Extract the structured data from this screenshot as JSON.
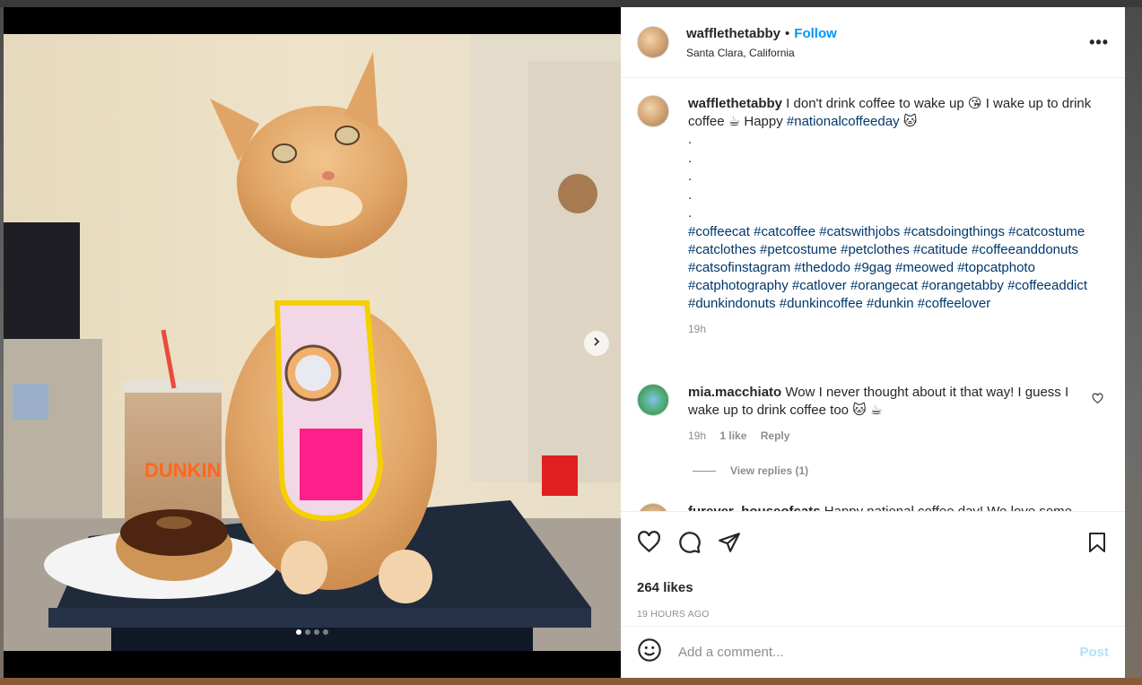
{
  "post": {
    "username": "wafflethetabby",
    "separator": "•",
    "follow_label": "Follow",
    "location": "Santa Clara, California",
    "more_label": "•••"
  },
  "caption": {
    "username": "wafflethetabby",
    "text_1": " I don't drink coffee to wake up 😘 I wake up to drink coffee ☕ Happy ",
    "tag_main": "#nationalcoffeeday",
    "emoji_end": " 🐱",
    "dots": [
      ".",
      ".",
      ".",
      ".",
      "."
    ],
    "hashtags": "#coffeecat #catcoffee #catswithjobs #catsdoingthings #catcostume #catclothes #petcostume #petclothes #catitude #coffeeanddonuts #catsofinstagram #thedodo #9gag #meowed #topcatphoto #catphotography #catlover #orangecat #orangetabby #coffeeaddict #dunkindonuts #dunkincoffee #dunkin #coffeelover",
    "time": "19h"
  },
  "comments": [
    {
      "username": "mia.macchiato",
      "text": " Wow I never thought about it that way! I guess I wake up to drink coffee too 🐱 ☕",
      "time": "19h",
      "likes": "1 like",
      "reply": "Reply"
    },
    {
      "username": "furever_houseofcats",
      "text": " Happy national coffee day! We love some"
    }
  ],
  "view_replies": "View replies (1)",
  "stats": {
    "likes": "264 likes",
    "timestamp": "19 HOURS AGO"
  },
  "add_comment": {
    "placeholder": "Add a comment...",
    "post_label": "Post"
  },
  "carousel": {
    "total": 4,
    "current": 1
  },
  "photo_text": {
    "cup_brand": "DUNKIN"
  },
  "colors": {
    "link_blue": "#0095f6",
    "hashtag": "#00376b",
    "muted": "#8e8e8e",
    "post_disabled": "#b2dffc"
  },
  "icons": [
    "next-chevron-icon",
    "more-icon",
    "heart-icon",
    "comment-icon",
    "share-icon",
    "bookmark-icon",
    "emoji-icon"
  ]
}
